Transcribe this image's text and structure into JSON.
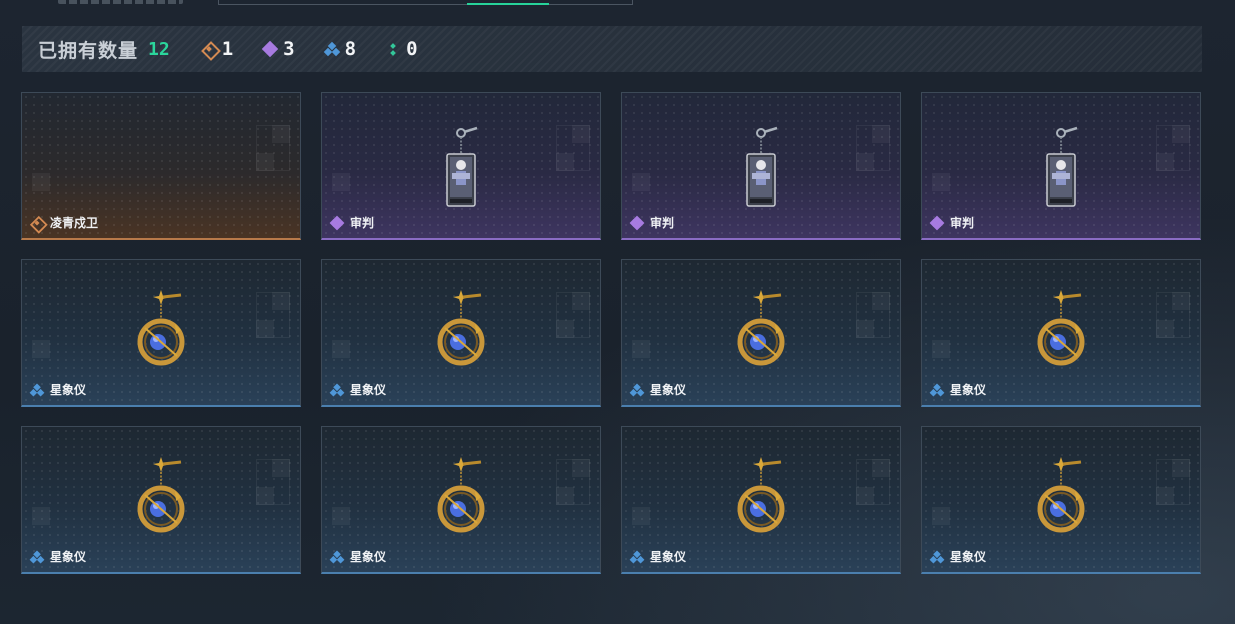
{
  "summary": {
    "label": "已拥有数量",
    "total": "12",
    "counts": [
      {
        "rarity": "orange",
        "icon": "orange-rarity-icon",
        "value": "1"
      },
      {
        "rarity": "purple",
        "icon": "purple-rarity-icon",
        "value": "3"
      },
      {
        "rarity": "blue",
        "icon": "blue-rarity-icon",
        "value": "8"
      },
      {
        "rarity": "green",
        "icon": "green-rarity-icon",
        "value": "0"
      }
    ]
  },
  "colors": {
    "accent": "#2bd69c",
    "orange": "#d48a52",
    "purple": "#a77be0",
    "blue": "#4f97d8",
    "green": "#33c79a"
  },
  "items": [
    {
      "name": "凌青戍卫",
      "rarity": "orange",
      "art": "none"
    },
    {
      "name": "审判",
      "rarity": "purple",
      "art": "tarot-card-charm-icon"
    },
    {
      "name": "审判",
      "rarity": "purple",
      "art": "tarot-card-charm-icon"
    },
    {
      "name": "审判",
      "rarity": "purple",
      "art": "tarot-card-charm-icon"
    },
    {
      "name": "星象仪",
      "rarity": "blue",
      "art": "astrolabe-charm-icon"
    },
    {
      "name": "星象仪",
      "rarity": "blue",
      "art": "astrolabe-charm-icon"
    },
    {
      "name": "星象仪",
      "rarity": "blue",
      "art": "astrolabe-charm-icon"
    },
    {
      "name": "星象仪",
      "rarity": "blue",
      "art": "astrolabe-charm-icon"
    },
    {
      "name": "星象仪",
      "rarity": "blue",
      "art": "astrolabe-charm-icon"
    },
    {
      "name": "星象仪",
      "rarity": "blue",
      "art": "astrolabe-charm-icon"
    },
    {
      "name": "星象仪",
      "rarity": "blue",
      "art": "astrolabe-charm-icon"
    },
    {
      "name": "星象仪",
      "rarity": "blue",
      "art": "astrolabe-charm-icon"
    }
  ]
}
